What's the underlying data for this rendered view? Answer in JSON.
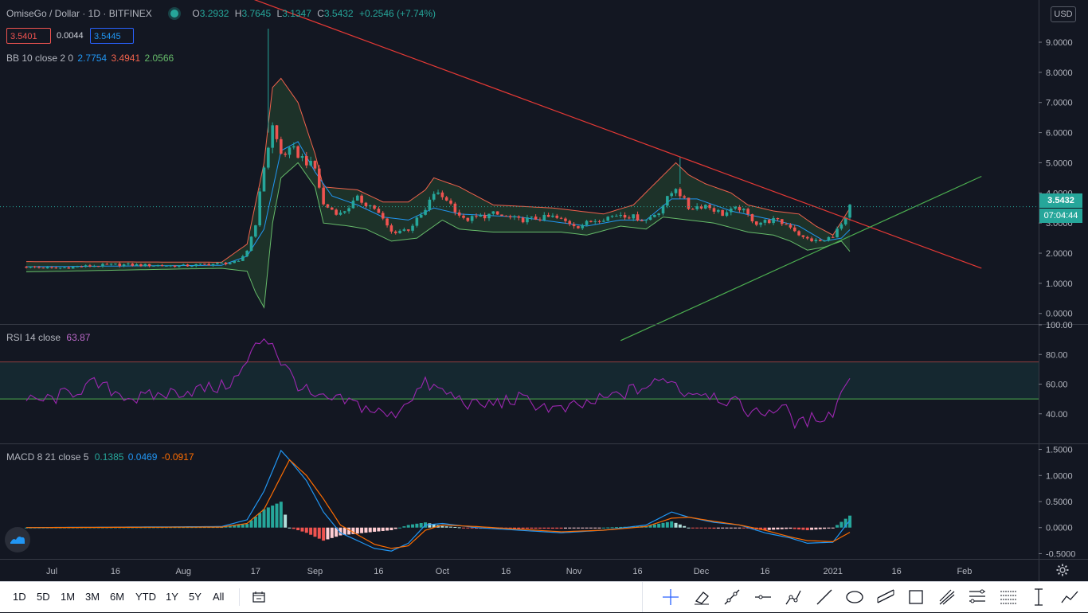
{
  "header": {
    "symbol": "OmiseGo / Dollar · 1D · BITFINEX",
    "o_label": "O",
    "o": "3.2932",
    "h_label": "H",
    "h": "3.7645",
    "l_label": "L",
    "l": "3.1347",
    "c_label": "C",
    "c": "3.5432",
    "change": "+0.2546 (+7.74%)",
    "bid": "3.5401",
    "spread": "0.0044",
    "ask": "3.5445",
    "bb_label": "BB 10 close 2 0",
    "bb_mid": "2.7754",
    "bb_upper": "3.4941",
    "bb_lower": "2.0566",
    "rsi_label": "RSI 14 close",
    "rsi_value": "63.87",
    "macd_label": "MACD 8 21 close 5",
    "macd_value": "0.1385",
    "macd_signal": "0.0469",
    "macd_hist": "-0.0917"
  },
  "price_scale": {
    "currency": "USD",
    "last_price": "3.5432",
    "countdown": "07:04:44"
  },
  "bottom_bar": {
    "ranges": [
      "1D",
      "5D",
      "1M",
      "3M",
      "6M",
      "YTD",
      "1Y",
      "5Y",
      "All"
    ]
  },
  "tools": [
    "crosshair-icon",
    "eraser-icon",
    "trend-line-icon",
    "horizontal-ray-icon",
    "polyline-icon",
    "line-icon",
    "ellipse-icon",
    "parallel-channel-icon",
    "rectangle-icon",
    "pitchfork-icon",
    "fib-retracement-icon",
    "fib-extension-icon",
    "measure-icon",
    "forecast-icon"
  ],
  "colors": {
    "background": "#131722",
    "up": "#26a69a",
    "down": "#ef5350",
    "bb_upper": "#f0624c",
    "bb_lower": "#66bb6a",
    "bb_mid": "#2196f3",
    "rsi": "#9c27b0",
    "macd": "#2196f3",
    "signal": "#ff6d00",
    "resistance": "#e53935",
    "support": "#4caf50"
  },
  "chart_data": [
    {
      "type": "candlestick",
      "title": "OmiseGo / Dollar · 1D · BITFINEX",
      "ylim": [
        -0.35,
        10.4
      ],
      "y_ticks": [
        "0.0000",
        "1.0000",
        "2.0000",
        "3.0000",
        "4.0000",
        "5.0000",
        "6.0000",
        "7.0000",
        "8.0000",
        "9.0000"
      ],
      "x_ticks": [
        "Jul",
        "16",
        "Aug",
        "17",
        "Sep",
        "16",
        "Oct",
        "16",
        "Nov",
        "16",
        "Dec",
        "16",
        "2021",
        "16",
        "Feb"
      ],
      "x_tick_days": [
        0,
        15,
        31,
        48,
        62,
        77,
        92,
        107,
        123,
        138,
        153,
        168,
        184,
        199,
        215
      ],
      "grid": false,
      "close_anchors": [
        [
          -6,
          1.55
        ],
        [
          0,
          1.5
        ],
        [
          15,
          1.62
        ],
        [
          31,
          1.58
        ],
        [
          44,
          1.7
        ],
        [
          46,
          2.1
        ],
        [
          48,
          3.0
        ],
        [
          50,
          4.9
        ],
        [
          52,
          6.2
        ],
        [
          54,
          5.3
        ],
        [
          57,
          5.4
        ],
        [
          62,
          4.8
        ],
        [
          64,
          3.6
        ],
        [
          68,
          3.3
        ],
        [
          72,
          3.8
        ],
        [
          76,
          3.5
        ],
        [
          80,
          2.7
        ],
        [
          84,
          2.8
        ],
        [
          88,
          3.4
        ],
        [
          90,
          4.0
        ],
        [
          93,
          3.8
        ],
        [
          97,
          3.1
        ],
        [
          104,
          3.3
        ],
        [
          110,
          3.1
        ],
        [
          118,
          3.2
        ],
        [
          124,
          2.9
        ],
        [
          128,
          3.1
        ],
        [
          134,
          3.3
        ],
        [
          140,
          3.1
        ],
        [
          143,
          3.4
        ],
        [
          147,
          4.2
        ],
        [
          150,
          3.5
        ],
        [
          154,
          3.6
        ],
        [
          158,
          3.3
        ],
        [
          162,
          3.5
        ],
        [
          166,
          3.0
        ],
        [
          170,
          3.1
        ],
        [
          174,
          2.9
        ],
        [
          177,
          2.5
        ],
        [
          180,
          2.4
        ],
        [
          182,
          2.4
        ],
        [
          184,
          2.6
        ],
        [
          187,
          3.1
        ],
        [
          188,
          3.54
        ]
      ],
      "bb_upper_anchors": [
        [
          -6,
          1.72
        ],
        [
          40,
          1.7
        ],
        [
          46,
          2.3
        ],
        [
          50,
          5.0
        ],
        [
          52,
          7.5
        ],
        [
          54,
          7.8
        ],
        [
          58,
          7.0
        ],
        [
          62,
          5.3
        ],
        [
          64,
          4.2
        ],
        [
          72,
          4.1
        ],
        [
          78,
          3.7
        ],
        [
          84,
          3.7
        ],
        [
          88,
          4.1
        ],
        [
          90,
          4.5
        ],
        [
          96,
          4.2
        ],
        [
          104,
          3.6
        ],
        [
          118,
          3.5
        ],
        [
          130,
          3.3
        ],
        [
          137,
          3.6
        ],
        [
          147,
          5.0
        ],
        [
          150,
          4.6
        ],
        [
          154,
          4.3
        ],
        [
          160,
          4.0
        ],
        [
          164,
          3.6
        ],
        [
          170,
          3.4
        ],
        [
          176,
          3.3
        ],
        [
          180,
          2.9
        ],
        [
          184,
          2.6
        ],
        [
          188,
          3.49
        ]
      ],
      "bb_lower_anchors": [
        [
          -6,
          1.38
        ],
        [
          40,
          1.5
        ],
        [
          46,
          1.4
        ],
        [
          48,
          0.7
        ],
        [
          50,
          0.2
        ],
        [
          52,
          3.0
        ],
        [
          54,
          4.5
        ],
        [
          58,
          5.0
        ],
        [
          62,
          4.2
        ],
        [
          64,
          3.0
        ],
        [
          70,
          2.9
        ],
        [
          74,
          2.8
        ],
        [
          80,
          2.4
        ],
        [
          86,
          2.5
        ],
        [
          92,
          3.1
        ],
        [
          96,
          2.8
        ],
        [
          104,
          2.7
        ],
        [
          120,
          2.7
        ],
        [
          126,
          2.6
        ],
        [
          134,
          2.9
        ],
        [
          140,
          2.8
        ],
        [
          144,
          3.2
        ],
        [
          150,
          3.1
        ],
        [
          156,
          3.0
        ],
        [
          164,
          2.7
        ],
        [
          170,
          2.6
        ],
        [
          174,
          2.4
        ],
        [
          178,
          2.1
        ],
        [
          182,
          2.2
        ],
        [
          186,
          2.4
        ],
        [
          188,
          2.06
        ]
      ],
      "bb_mid_anchors": [
        [
          -6,
          1.55
        ],
        [
          40,
          1.6
        ],
        [
          46,
          1.9
        ],
        [
          50,
          2.8
        ],
        [
          54,
          5.4
        ],
        [
          58,
          5.7
        ],
        [
          62,
          4.7
        ],
        [
          66,
          3.9
        ],
        [
          72,
          3.6
        ],
        [
          78,
          3.2
        ],
        [
          84,
          3.1
        ],
        [
          90,
          3.5
        ],
        [
          96,
          3.3
        ],
        [
          110,
          3.2
        ],
        [
          126,
          2.9
        ],
        [
          134,
          3.1
        ],
        [
          140,
          3.1
        ],
        [
          146,
          3.8
        ],
        [
          152,
          3.8
        ],
        [
          160,
          3.4
        ],
        [
          170,
          3.1
        ],
        [
          176,
          2.9
        ],
        [
          182,
          2.4
        ],
        [
          186,
          2.5
        ],
        [
          188,
          2.78
        ]
      ],
      "trend_lines": [
        {
          "name": "resistance",
          "p1": [
            47,
            10.45
          ],
          "p2": [
            219,
            1.5
          ]
        },
        {
          "name": "support",
          "p1": [
            134,
            -0.9
          ],
          "p2": [
            219,
            4.55
          ]
        }
      ]
    },
    {
      "type": "line",
      "title": "RSI 14 close",
      "ylim": [
        20,
        100
      ],
      "y_ticks": [
        "40.00",
        "60.00",
        "80.00",
        "100.00"
      ],
      "bands": {
        "upper": 75,
        "lower": 50
      },
      "series": [
        {
          "name": "RSI",
          "anchors": [
            [
              -6,
              48
            ],
            [
              0,
              50
            ],
            [
              10,
              60
            ],
            [
              20,
              50
            ],
            [
              30,
              55
            ],
            [
              40,
              58
            ],
            [
              44,
              65
            ],
            [
              48,
              85
            ],
            [
              50,
              92
            ],
            [
              52,
              88
            ],
            [
              54,
              75
            ],
            [
              58,
              60
            ],
            [
              62,
              50
            ],
            [
              70,
              48
            ],
            [
              80,
              38
            ],
            [
              84,
              50
            ],
            [
              88,
              60
            ],
            [
              92,
              55
            ],
            [
              100,
              45
            ],
            [
              110,
              50
            ],
            [
              120,
              42
            ],
            [
              128,
              48
            ],
            [
              136,
              55
            ],
            [
              142,
              60
            ],
            [
              146,
              65
            ],
            [
              148,
              55
            ],
            [
              154,
              55
            ],
            [
              160,
              48
            ],
            [
              166,
              40
            ],
            [
              172,
              45
            ],
            [
              176,
              32
            ],
            [
              180,
              38
            ],
            [
              184,
              40
            ],
            [
              186,
              55
            ],
            [
              188,
              63.87
            ]
          ]
        }
      ]
    },
    {
      "type": "line",
      "title": "MACD 8 21 close 5",
      "ylim": [
        -0.6,
        1.6
      ],
      "y_ticks": [
        "-0.5000",
        "0.0000",
        "0.5000",
        "1.0000",
        "1.5000"
      ],
      "series": [
        {
          "name": "MACD",
          "anchors": [
            [
              -6,
              0
            ],
            [
              40,
              0.02
            ],
            [
              46,
              0.15
            ],
            [
              50,
              0.7
            ],
            [
              54,
              1.48
            ],
            [
              56,
              1.3
            ],
            [
              60,
              0.9
            ],
            [
              64,
              0.3
            ],
            [
              68,
              -0.1
            ],
            [
              76,
              -0.4
            ],
            [
              80,
              -0.45
            ],
            [
              84,
              -0.3
            ],
            [
              88,
              0.05
            ],
            [
              92,
              0.08
            ],
            [
              100,
              0
            ],
            [
              120,
              -0.1
            ],
            [
              130,
              -0.05
            ],
            [
              140,
              0.05
            ],
            [
              146,
              0.3
            ],
            [
              150,
              0.2
            ],
            [
              156,
              0.1
            ],
            [
              162,
              0.05
            ],
            [
              168,
              -0.1
            ],
            [
              174,
              -0.2
            ],
            [
              178,
              -0.3
            ],
            [
              184,
              -0.28
            ],
            [
              188,
              0.14
            ]
          ]
        },
        {
          "name": "Signal",
          "anchors": [
            [
              -6,
              0
            ],
            [
              40,
              0.01
            ],
            [
              46,
              0.08
            ],
            [
              50,
              0.35
            ],
            [
              56,
              1.3
            ],
            [
              60,
              1.0
            ],
            [
              64,
              0.55
            ],
            [
              68,
              0.05
            ],
            [
              76,
              -0.32
            ],
            [
              80,
              -0.4
            ],
            [
              84,
              -0.35
            ],
            [
              88,
              -0.05
            ],
            [
              92,
              0.05
            ],
            [
              100,
              0.02
            ],
            [
              120,
              -0.08
            ],
            [
              130,
              -0.05
            ],
            [
              140,
              0.02
            ],
            [
              146,
              0.18
            ],
            [
              150,
              0.2
            ],
            [
              156,
              0.12
            ],
            [
              162,
              0.05
            ],
            [
              168,
              -0.05
            ],
            [
              174,
              -0.18
            ],
            [
              178,
              -0.25
            ],
            [
              184,
              -0.27
            ],
            [
              188,
              -0.09
            ]
          ]
        }
      ]
    }
  ]
}
